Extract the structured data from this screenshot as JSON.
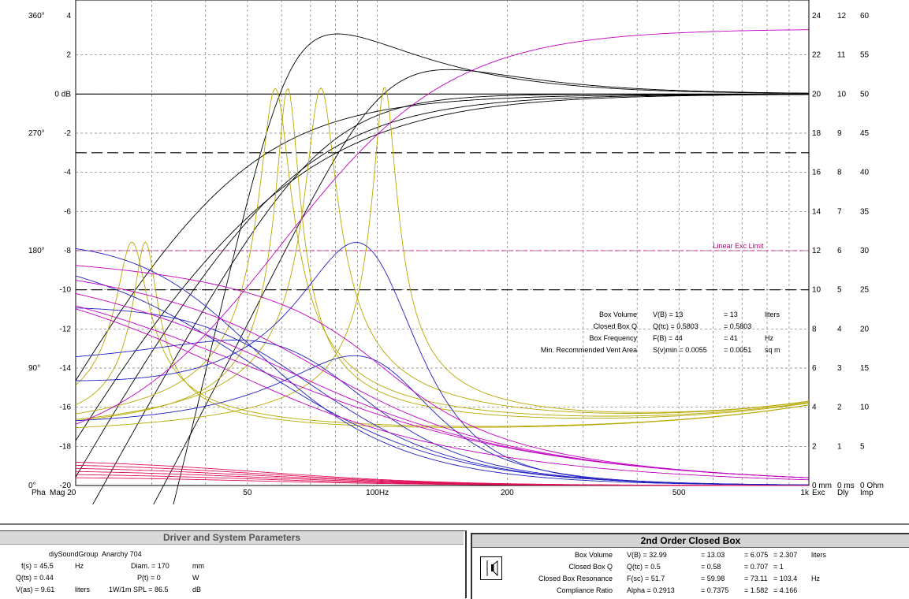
{
  "chart_data": {
    "type": "line",
    "x_axis": {
      "scale": "log",
      "range": [
        20,
        1000
      ],
      "tick_labels": [
        {
          "value": 20,
          "label": "Mag 20"
        },
        {
          "value": 50,
          "label": "50"
        },
        {
          "value": 100,
          "label": "100Hz"
        },
        {
          "value": 200,
          "label": "200"
        },
        {
          "value": 500,
          "label": "500"
        },
        {
          "value": 1000,
          "label": "1k"
        }
      ]
    },
    "y_axis_magnitude": {
      "unit": "dB",
      "range": [
        -20,
        4
      ],
      "tick_labels": [
        "4",
        "2",
        "0 dB",
        "-2",
        "-4",
        "-6",
        "-8",
        "-10",
        "-12",
        "-14",
        "-16",
        "-18",
        "-20"
      ]
    },
    "y_axis_phase": {
      "label": "Pha",
      "tick_labels": [
        {
          "value": 360,
          "label": "360°"
        },
        {
          "value": 270,
          "label": "270°"
        },
        {
          "value": 180,
          "label": "180°"
        },
        {
          "value": 90,
          "label": "90°"
        },
        {
          "value": 0,
          "label": "0°"
        }
      ]
    },
    "right_axes": [
      {
        "label": "Exc",
        "color": "#c0007a",
        "ticks": [
          "24",
          "22",
          "20",
          "18",
          "16",
          "14",
          "12",
          "10",
          "8",
          "6",
          "4",
          "2",
          "0 mm"
        ]
      },
      {
        "label": "Dly",
        "color": "#3030c8",
        "ticks": [
          "12",
          "11",
          "10",
          "9",
          "8",
          "7",
          "6",
          "5",
          "4",
          "3",
          "2",
          "1",
          "0 ms"
        ]
      },
      {
        "label": "Imp",
        "color": "#b8a800",
        "ticks": [
          "60",
          "55",
          "50",
          "45",
          "40",
          "35",
          "30",
          "25",
          "20",
          "15",
          "10",
          "5",
          "0 Ohm"
        ]
      }
    ],
    "reference_lines": [
      {
        "y_db": 0,
        "style": "solid"
      },
      {
        "y_db": -3,
        "style": "dashed"
      },
      {
        "y_db": -10,
        "style": "dashed"
      },
      {
        "y_db": -8,
        "style": "dashed",
        "color": "#c0007a",
        "label": "Linear Exc Limit"
      }
    ],
    "series": [
      {
        "kind": "magnitude",
        "color": "#000000",
        "boxes": [
          {
            "fb": 51.7,
            "q": 0.5
          },
          {
            "fb": 59.98,
            "q": 0.58
          },
          {
            "fb": 73.11,
            "q": 0.707
          },
          {
            "fb": 103.4,
            "q": 1.0
          },
          {
            "fb": 44,
            "q": 0.5803
          }
        ]
      },
      {
        "kind": "impedance",
        "color": "#b8a800",
        "peaks_hz": [
          27,
          29,
          58,
          62,
          74,
          104
        ]
      },
      {
        "kind": "delay",
        "color": "#2020c0"
      },
      {
        "kind": "phase",
        "color": "#c000c0"
      },
      {
        "kind": "excursion",
        "color": "#e0105a"
      }
    ],
    "grid": true
  },
  "vented_info": {
    "rows": [
      {
        "label": "Box Volume",
        "formula": "V(B) = 13",
        "result": "= 13",
        "unit": "liters"
      },
      {
        "label": "Closed Box Q",
        "formula": "Q(tc) = 0.5803",
        "result": "= 0.5803",
        "unit": ""
      },
      {
        "label": "Box Frequency",
        "formula": "F(B) = 44",
        "result": "= 41",
        "unit": "Hz"
      },
      {
        "label": "Min. Recommended Vent Area",
        "formula": "S(v)min = 0.0055",
        "result": "= 0.0051",
        "unit": "sq m"
      }
    ]
  },
  "driver_panel": {
    "title": "Driver and System Parameters",
    "driver_name": "diySoundGroup  Anarchy 704",
    "params": [
      {
        "label": "f(s) = 45.5",
        "unit": "Hz"
      },
      {
        "label": "Q(ts) = 0.44",
        "unit": ""
      },
      {
        "label": "V(as) = 9.61",
        "unit": "liters"
      }
    ],
    "params2": [
      {
        "label": "Diam. = 170",
        "unit": "mm"
      },
      {
        "label": "P(t) = 0",
        "unit": "W"
      },
      {
        "label": "1W/1m SPL = 86.5",
        "unit": "dB"
      }
    ]
  },
  "closed_box_panel": {
    "title": "2nd Order Closed Box",
    "rows": [
      {
        "label": "Box Volume",
        "values": [
          "V(B) = 32.99",
          "= 13.03",
          "= 6.075",
          "= 2.307"
        ],
        "unit": "liters"
      },
      {
        "label": "Closed Box Q",
        "values": [
          "Q(tc) = 0.5",
          "= 0.58",
          "= 0.707",
          "= 1"
        ],
        "unit": ""
      },
      {
        "label": "Closed Box Resonance",
        "values": [
          "F(sc) = 51.7",
          "= 59.98",
          "= 73.11",
          "= 103.4"
        ],
        "unit": "Hz"
      },
      {
        "label": "Compliance Ratio",
        "values": [
          "Alpha = 0.2913",
          "= 0.7375",
          "= 1.582",
          "= 4.166"
        ],
        "unit": ""
      }
    ]
  }
}
